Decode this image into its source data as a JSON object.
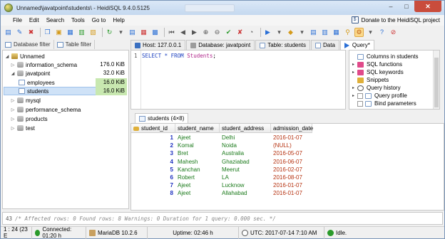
{
  "window": {
    "title": "Unnamed\\javatpoint\\students\\ - HeidiSQL 9.4.0.5125"
  },
  "menu": [
    "File",
    "Edit",
    "Search",
    "Tools",
    "Go to",
    "Help"
  ],
  "donate_label": "Donate to the HeidiSQL project",
  "left_tabs": {
    "database_filter": "Database filter",
    "table_filter": "Table filter"
  },
  "tree": [
    {
      "label": "Unnamed",
      "size": "",
      "level": 0,
      "type": "server",
      "expanded": true
    },
    {
      "label": "information_schema",
      "size": "176.0 KiB",
      "level": 1,
      "type": "db",
      "expanded": false
    },
    {
      "label": "javatpoint",
      "size": "32.0 KiB",
      "level": 1,
      "type": "db",
      "expanded": true
    },
    {
      "label": "employees",
      "size": "16.0 KiB",
      "level": 2,
      "type": "table"
    },
    {
      "label": "students",
      "size": "16.0 KiB",
      "level": 2,
      "type": "table",
      "selected": true
    },
    {
      "label": "mysql",
      "size": "",
      "level": 1,
      "type": "db",
      "expanded": false
    },
    {
      "label": "performance_schema",
      "size": "",
      "level": 1,
      "type": "db",
      "expanded": false
    },
    {
      "label": "products",
      "size": "",
      "level": 1,
      "type": "db",
      "expanded": false
    },
    {
      "label": "test",
      "size": "",
      "level": 1,
      "type": "db",
      "expanded": false
    }
  ],
  "main_tabs": [
    {
      "label": "Host: 127.0.0.1"
    },
    {
      "label": "Database: javatpoint"
    },
    {
      "label": "Table: students"
    },
    {
      "label": "Data"
    },
    {
      "label": "Query*"
    }
  ],
  "editor": {
    "line_number": "1",
    "sql_keywords_1": "SELECT * FROM",
    "sql_table": "Students",
    "sql_end": ";"
  },
  "helper_panel": [
    {
      "label": "Columns in students",
      "arrow": "",
      "check": false
    },
    {
      "label": "SQL functions",
      "arrow": "▸",
      "check": false
    },
    {
      "label": "SQL keywords",
      "arrow": "▸",
      "check": false
    },
    {
      "label": "Snippets",
      "arrow": "",
      "check": false
    },
    {
      "label": "Query history",
      "arrow": "▸",
      "check": false
    },
    {
      "label": "Query profile",
      "arrow": "▸",
      "check": true
    },
    {
      "label": "Bind parameters",
      "arrow": "",
      "check": true
    }
  ],
  "result_tab": "students (4×8)",
  "columns": [
    "student_id",
    "student_name",
    "student_address",
    "admission_date"
  ],
  "rows": [
    [
      "1",
      "Ajeet",
      "Delhi",
      "2016-01-07"
    ],
    [
      "2",
      "Komal",
      "Noida",
      "(NULL)"
    ],
    [
      "3",
      "Bret",
      "Australia",
      "2016-05-07"
    ],
    [
      "4",
      "Mahesh",
      "Ghaziabad",
      "2016-06-07"
    ],
    [
      "5",
      "Kanchan",
      "Meerut",
      "2016-02-07"
    ],
    [
      "6",
      "Robert",
      "LA",
      "2016-08-07"
    ],
    [
      "7",
      "Ajeet",
      "Lucknow",
      "2016-01-07"
    ],
    [
      "8",
      "Ajeet",
      "Allahabad",
      "2016-01-07"
    ]
  ],
  "log": {
    "line": "43",
    "text": "/* Affected rows: 0  Found rows: 8  Warnings: 0  Duration for 1 query: 0.000 sec. */"
  },
  "status": {
    "cursor": "1 : 24 (23 E",
    "connected": "Connected: 01:20 h",
    "server": "MariaDB 10.2.6",
    "uptime": "Uptime: 02:46 h",
    "utc": "UTC: 2017-07-14 7:10 AM",
    "state": "Idle."
  },
  "colors": {
    "title_bar": "#c4d8ef",
    "close_button": "#c94c3c",
    "numbers": "#1c2fbf",
    "strings": "#1b7a1b",
    "dates": "#b5300e",
    "sql_keyword": "#1a3fbf"
  }
}
